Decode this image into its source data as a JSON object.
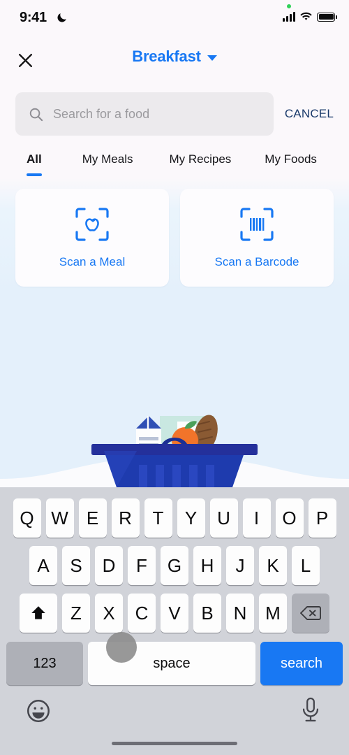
{
  "status_bar": {
    "time": "9:41",
    "dnd_icon": "moon-icon",
    "signal_icon": "cellular-signal-icon",
    "wifi_icon": "wifi-icon",
    "battery_icon": "battery-icon",
    "recording_dot": "green-status-dot"
  },
  "nav": {
    "close_icon": "close-icon",
    "title": "Breakfast",
    "dropdown_icon": "chevron-down-icon"
  },
  "search": {
    "icon": "search-icon",
    "value": "",
    "placeholder": "Search for a food",
    "cancel_label": "CANCEL"
  },
  "tabs": [
    {
      "label": "All",
      "active": true
    },
    {
      "label": "My Meals",
      "active": false
    },
    {
      "label": "My Recipes",
      "active": false
    },
    {
      "label": "My Foods",
      "active": false
    }
  ],
  "cards": [
    {
      "label": "Scan a Meal",
      "icon": "scan-apple-icon"
    },
    {
      "label": "Scan a Barcode",
      "icon": "scan-barcode-icon"
    }
  ],
  "illustration": {
    "name": "grocery-basket-illustration",
    "items": [
      "milk-carton",
      "green-box",
      "orange",
      "bread-loaf",
      "shopping-basket"
    ]
  },
  "keyboard": {
    "row1": [
      "Q",
      "W",
      "E",
      "R",
      "T",
      "Y",
      "U",
      "I",
      "O",
      "P"
    ],
    "row2": [
      "A",
      "S",
      "D",
      "F",
      "G",
      "H",
      "J",
      "K",
      "L"
    ],
    "row3": [
      "Z",
      "X",
      "C",
      "V",
      "B",
      "N",
      "M"
    ],
    "shift_icon": "shift-icon",
    "backspace_icon": "backspace-icon",
    "numeric_label": "123",
    "space_label": "space",
    "return_label": "search",
    "emoji_icon": "emoji-icon",
    "mic_icon": "microphone-icon",
    "home_indicator": "home-indicator"
  },
  "colors": {
    "accent": "#1878f3",
    "cancel": "#1a3a6b",
    "keyboard_bg": "#d1d3d9",
    "page_bg": "#e4f0fb"
  }
}
